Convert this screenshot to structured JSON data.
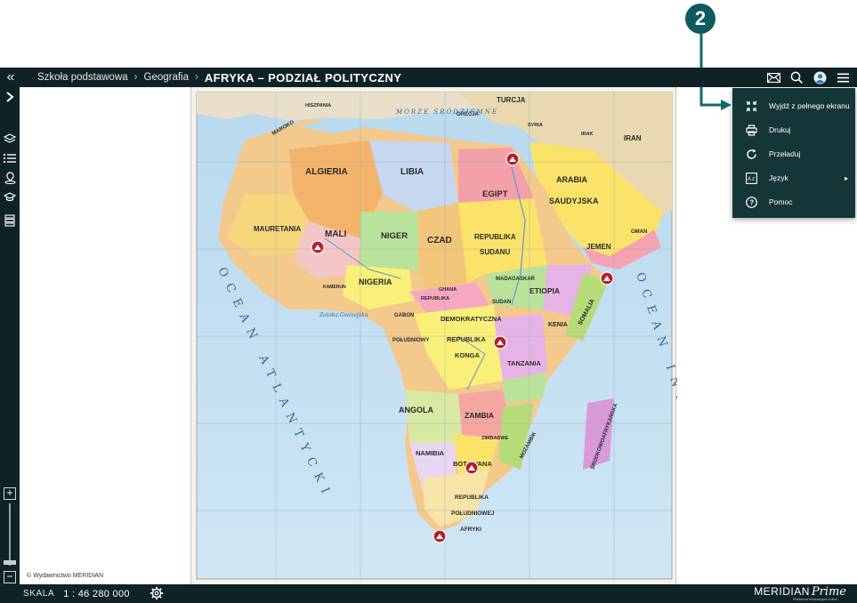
{
  "callout": {
    "number": "2"
  },
  "topbar": {
    "breadcrumb": [
      "Szkoła podstawowa",
      "Geografia"
    ],
    "separator": "›",
    "title": "AFRYKA – PODZIAŁ POLITYCZNY",
    "icons": [
      "back-icon",
      "mail-icon",
      "search-icon",
      "user-icon",
      "menu-icon"
    ]
  },
  "sidebar": {
    "icons": [
      "expand-icon",
      "layers-icon",
      "legend-icon",
      "location-icon",
      "education-icon",
      "list-icon"
    ],
    "zoom": {
      "in": "+",
      "out": "−",
      "level": 0.05
    }
  },
  "menu": {
    "items": [
      {
        "label": "Wyjdź z pełnego ekranu",
        "icon": "exit-fullscreen-icon"
      },
      {
        "label": "Drukuj",
        "icon": "print-icon"
      },
      {
        "label": "Przeładuj",
        "icon": "reload-icon"
      },
      {
        "label": "Język",
        "icon": "language-icon"
      },
      {
        "label": "Pomoc",
        "icon": "help-icon"
      }
    ],
    "submenu_arrow": "▸"
  },
  "map": {
    "copyright": "© Wydawnictwo MERIDIAN",
    "labels": [
      "ALGIERIA",
      "LIBIA",
      "EGIPT",
      "MALI",
      "NIGER",
      "CZAD",
      "MAURETANIA",
      "SUDAN",
      "REPUBLIKA",
      "SUDANU",
      "NIGERIA",
      "ETIOPIA",
      "SOMALIA",
      "KENIA",
      "DEMOKRATYCZNA",
      "REPUBLIKA",
      "KONGA",
      "TANZANIA",
      "ANGOLA",
      "ZAMBIA",
      "NAMIBIA",
      "BOTSWANA",
      "REPUBLIKA",
      "POŁUDNIOWEJ",
      "AFRYKI",
      "ARABIA",
      "SAUDYJSKA",
      "JEMEN",
      "OMAN",
      "TURCJA",
      "IRAN",
      "GRECJA",
      "HISZPANIA",
      "MAROKO",
      "SYRIA",
      "IRAK",
      "ZIMBABWE",
      "MOZAMBIK",
      "MADAGASKAR",
      "SUDAN",
      "POŁUDNIOWY",
      "GABON",
      "KAMERUN",
      "GHANA",
      "REPUBLIKA",
      "ŚRODKOWOAFRYKAŃSKA"
    ],
    "ocean_labels": [
      "OCEAN ATLANTYCKI",
      "OCEAN INDYJSKI"
    ],
    "sea_labels": [
      "MORZE ŚRÓDZIEMNE",
      "Zatoka Gwinejska"
    ]
  },
  "bottombar": {
    "scale_label": "SKALA",
    "scale_value": "1 : 46 280 000",
    "brand": "MERIDIAN",
    "brand_script": "Prime",
    "brand_tag": "Platforma edukacyjna online"
  }
}
